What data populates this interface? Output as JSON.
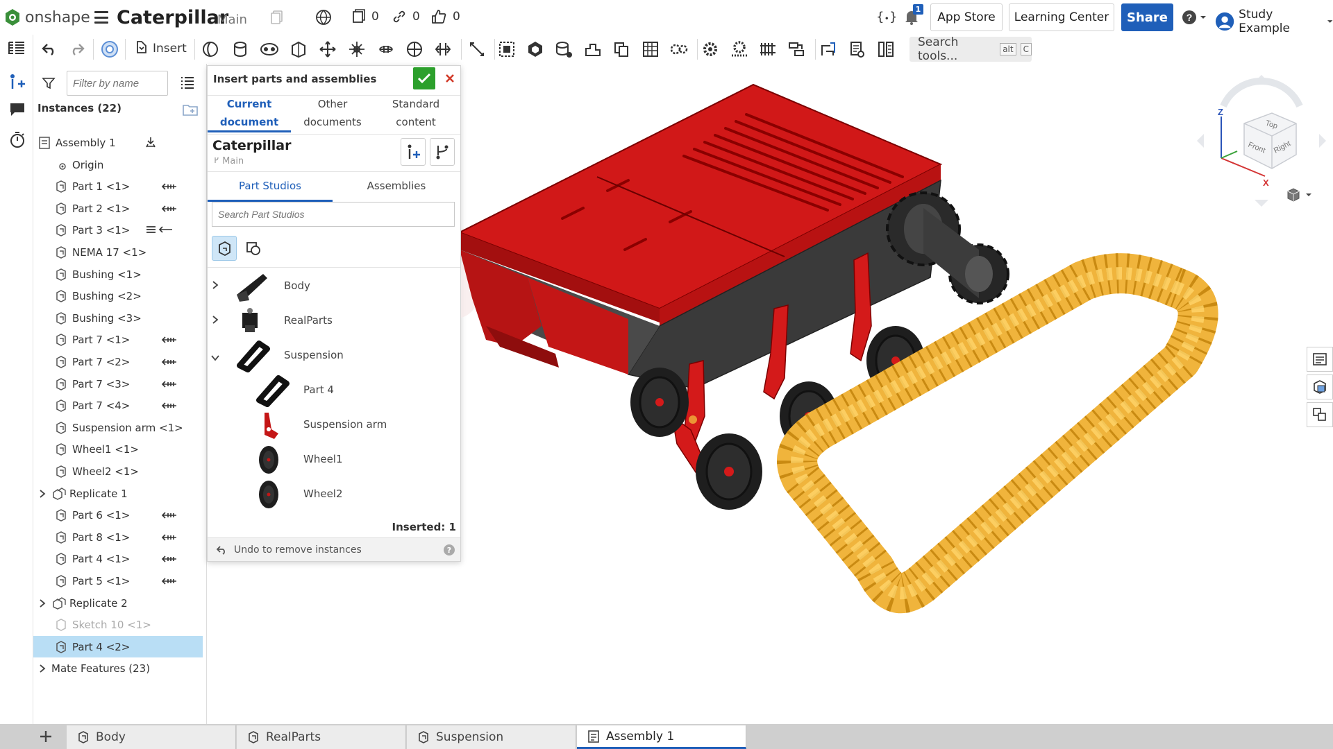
{
  "topbar": {
    "logo_text": "onshape",
    "doc_title": "Caterpillar",
    "doc_branch": "Main",
    "versions_count": "0",
    "links_count": "0",
    "likes_count": "0",
    "notif_count": "1",
    "app_store": "App Store",
    "learning_center": "Learning Center",
    "share": "Share",
    "user_name": "Study Example",
    "brand_color": "#1f5fb9"
  },
  "toolbar": {
    "insert_label": "Insert",
    "search_tools": "Search tools...",
    "kbd_alt": "alt",
    "kbd_c": "C"
  },
  "featurelist": {
    "filter_placeholder": "Filter by name",
    "instances_title": "Instances (22)",
    "rows": [
      {
        "label": "Assembly 1"
      },
      {
        "label": "Origin"
      },
      {
        "label": "Part 1 <1>"
      },
      {
        "label": "Part 2 <1>"
      },
      {
        "label": "Part 3 <1>"
      },
      {
        "label": "NEMA 17 <1>"
      },
      {
        "label": "Bushing <1>"
      },
      {
        "label": "Bushing <2>"
      },
      {
        "label": "Bushing <3>"
      },
      {
        "label": "Part 7 <1>"
      },
      {
        "label": "Part 7 <2>"
      },
      {
        "label": "Part 7 <3>"
      },
      {
        "label": "Part 7 <4>"
      },
      {
        "label": "Suspension arm <1>"
      },
      {
        "label": "Wheel1 <1>"
      },
      {
        "label": "Wheel2 <1>"
      },
      {
        "label": "Replicate 1"
      },
      {
        "label": "Part 6 <1>"
      },
      {
        "label": "Part 8 <1>"
      },
      {
        "label": "Part 4 <1>"
      },
      {
        "label": "Part 5 <1>"
      },
      {
        "label": "Replicate 2"
      },
      {
        "label": "Sketch 10 <1>"
      },
      {
        "label": "Part 4 <2>"
      },
      {
        "label": "Mate Features (23)"
      }
    ]
  },
  "dialog": {
    "title": "Insert parts and assemblies",
    "tabs": [
      "Current document",
      "Other documents",
      "Standard content"
    ],
    "tab_lines": [
      [
        "Current",
        "document"
      ],
      [
        "Other",
        "documents"
      ],
      [
        "Standard",
        "content"
      ]
    ],
    "context_name": "Caterpillar",
    "context_branch": "Main",
    "subtabs": [
      "Part Studios",
      "Assemblies"
    ],
    "search_placeholder": "Search Part Studios",
    "items": [
      {
        "name": "Body"
      },
      {
        "name": "RealParts"
      },
      {
        "name": "Suspension"
      },
      {
        "name": "Part 4"
      },
      {
        "name": "Suspension arm"
      },
      {
        "name": "Wheel1"
      },
      {
        "name": "Wheel2"
      }
    ],
    "inserted": "Inserted: 1",
    "undo": "Undo to remove instances"
  },
  "viewcube": {
    "top": "Top",
    "front": "Front",
    "right": "Right",
    "z": "Z",
    "x": "X"
  },
  "bottom_tabs": [
    "Body",
    "RealParts",
    "Suspension",
    "Assembly 1"
  ]
}
